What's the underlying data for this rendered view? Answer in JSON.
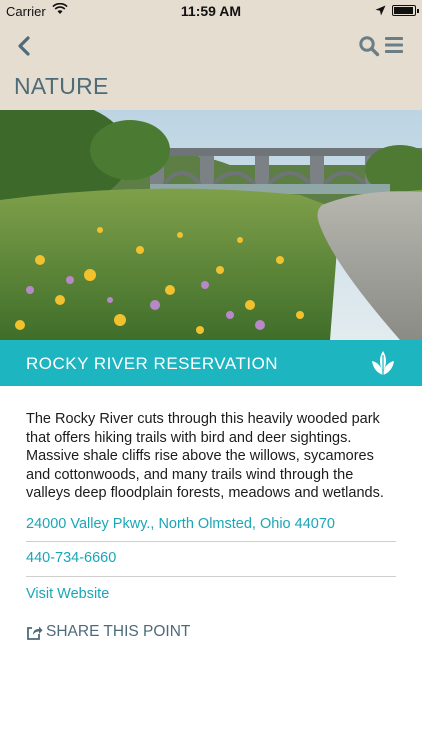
{
  "status_bar": {
    "carrier": "Carrier",
    "time": "11:59 AM",
    "battery_level": 0.95
  },
  "header": {
    "title": "NATURE",
    "back_icon": "chevron-left-icon",
    "search_icon": "search-icon",
    "menu_icon": "hamburger-menu-icon"
  },
  "hero": {
    "icon": "photo"
  },
  "place": {
    "name": "ROCKY RIVER RESERVATION",
    "category_icon": "leaf-icon",
    "description": "The Rocky River cuts through this heavily wooded park that offers hiking trails with bird and deer sightings. Massive shale cliffs rise above the willows, sycamores and cottonwoods, and many trails wind through the valleys deep floodplain forests, meadows and wetlands.",
    "address": "24000 Valley Pkwy., North Olmsted, Ohio 44070",
    "phone": "440-734-6660",
    "website_label": "Visit Website",
    "share_label": "SHARE THIS POINT"
  },
  "colors": {
    "header_bg": "#e6ddd1",
    "accent": "#1cb5c0",
    "link": "#1aa6b7",
    "title": "#4d6b78"
  }
}
